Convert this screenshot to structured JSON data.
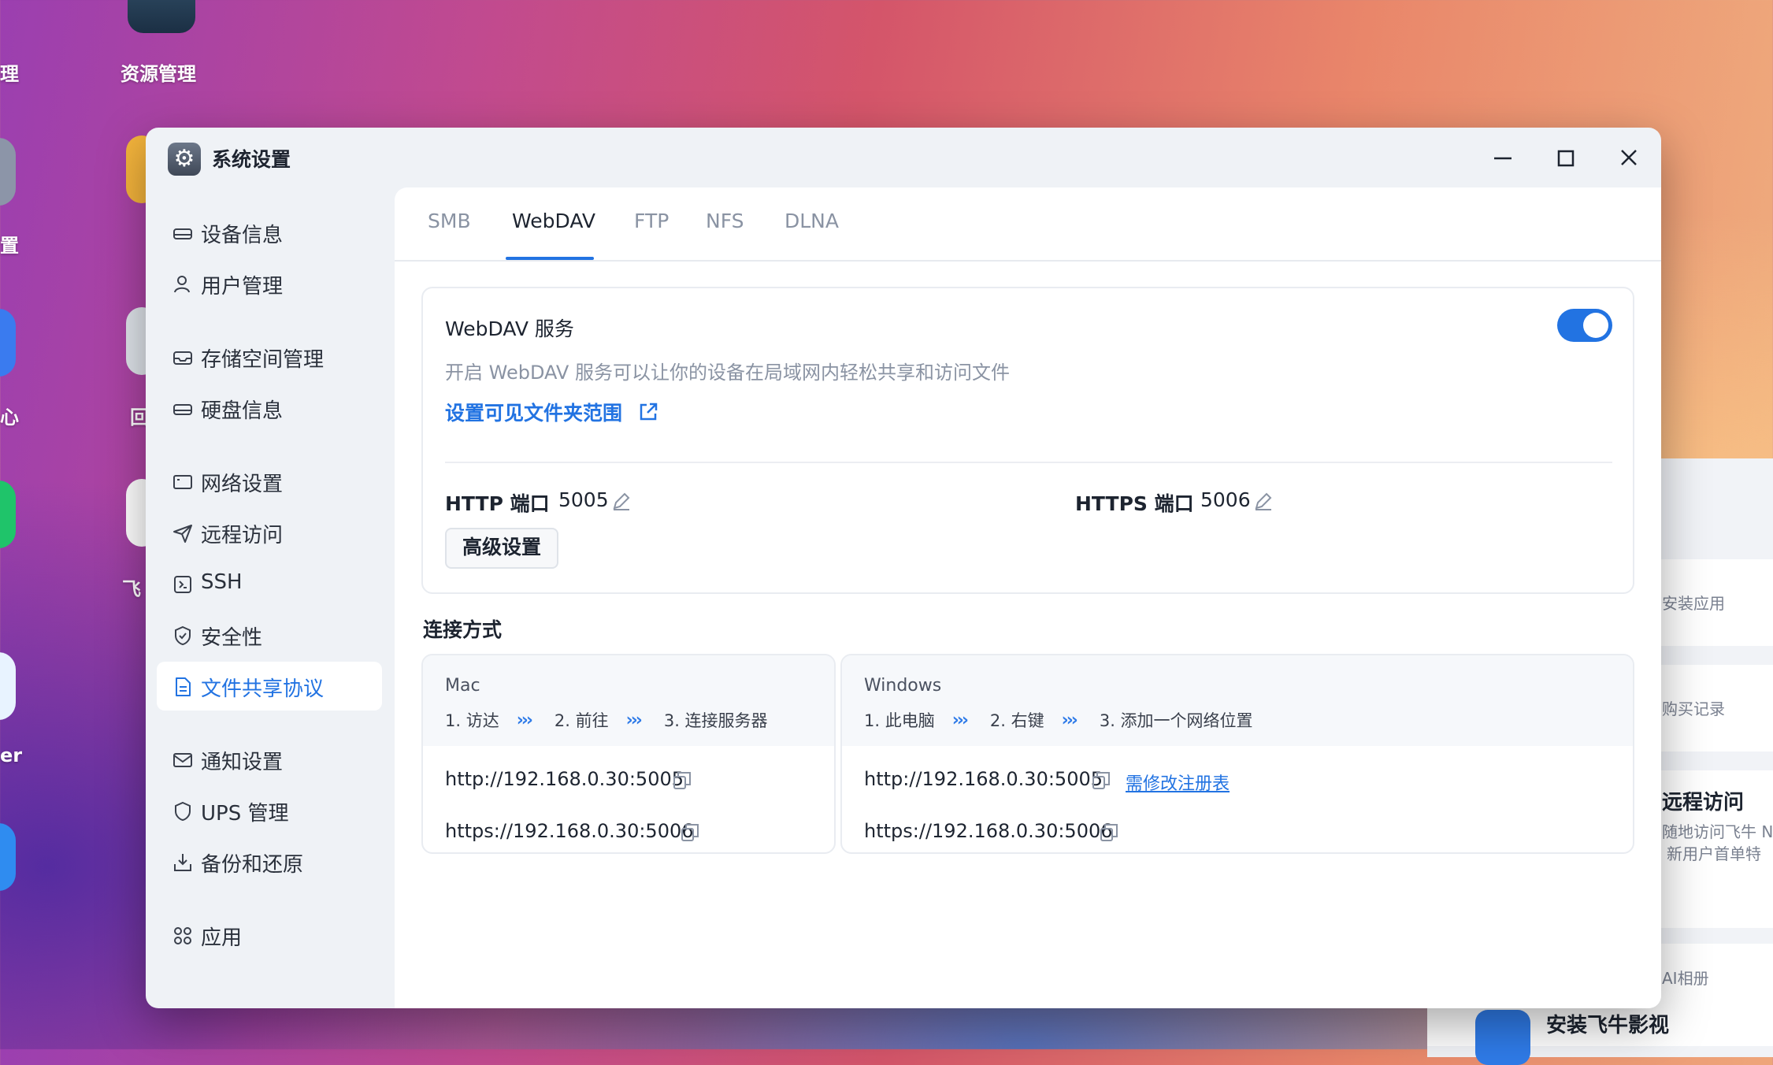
{
  "desktop": {
    "labels": [
      "理",
      "资源管理",
      "置",
      "心",
      "回",
      "飞",
      "er"
    ]
  },
  "side_panel": {
    "item1": "安装应用",
    "item2": "购买记录",
    "remote_title": "远程访问",
    "remote_desc1": "随地访问飞牛 NA",
    "remote_desc2": "新用户首单特",
    "item3": "AI相册",
    "movie_title": "安装飞牛影视"
  },
  "window": {
    "title": "系统设置",
    "icon": "gear-icon"
  },
  "sidebar": {
    "items": [
      {
        "label": "设备信息",
        "icon": "hdd-icon"
      },
      {
        "label": "用户管理",
        "icon": "user-icon"
      },
      {
        "label": "存储空间管理",
        "icon": "storage-icon"
      },
      {
        "label": "硬盘信息",
        "icon": "disk-icon"
      },
      {
        "label": "网络设置",
        "icon": "network-icon"
      },
      {
        "label": "远程访问",
        "icon": "send-icon"
      },
      {
        "label": "SSH",
        "icon": "terminal-icon"
      },
      {
        "label": "安全性",
        "icon": "shield-check-icon"
      },
      {
        "label": "文件共享协议",
        "icon": "document-icon"
      },
      {
        "label": "通知设置",
        "icon": "mail-icon"
      },
      {
        "label": "UPS 管理",
        "icon": "shield-icon"
      },
      {
        "label": "备份和还原",
        "icon": "download-tray-icon"
      },
      {
        "label": "应用",
        "icon": "apps-grid-icon"
      }
    ],
    "active_index": 8
  },
  "tabs": [
    "SMB",
    "WebDAV",
    "FTP",
    "NFS",
    "DLNA"
  ],
  "active_tab": "WebDAV",
  "service": {
    "title": "WebDAV 服务",
    "enabled": true,
    "description": "开启 WebDAV 服务可以让你的设备在局域网内轻松共享和访问文件",
    "folder_link": "设置可见文件夹范围",
    "http_label": "HTTP 端口",
    "http_port": "5005",
    "https_label": "HTTPS 端口",
    "https_port": "5006",
    "advanced_button": "高级设置"
  },
  "connection": {
    "title": "连接方式",
    "mac": {
      "os": "Mac",
      "steps": [
        "1. 访达",
        "2. 前往",
        "3. 连接服务器"
      ],
      "http_url": "http://192.168.0.30:5005",
      "https_url": "https://192.168.0.30:5006"
    },
    "windows": {
      "os": "Windows",
      "steps": [
        "1. 此电脑",
        "2. 右键",
        "3. 添加一个网络位置"
      ],
      "http_url": "http://192.168.0.30:5005",
      "registry_link": "需修改注册表",
      "https_url": "https://192.168.0.30:5006"
    },
    "arrow": "›››"
  },
  "colors": {
    "accent": "#2273e2",
    "muted_text": "#8a93a3",
    "window_bg": "#eff2f6"
  }
}
